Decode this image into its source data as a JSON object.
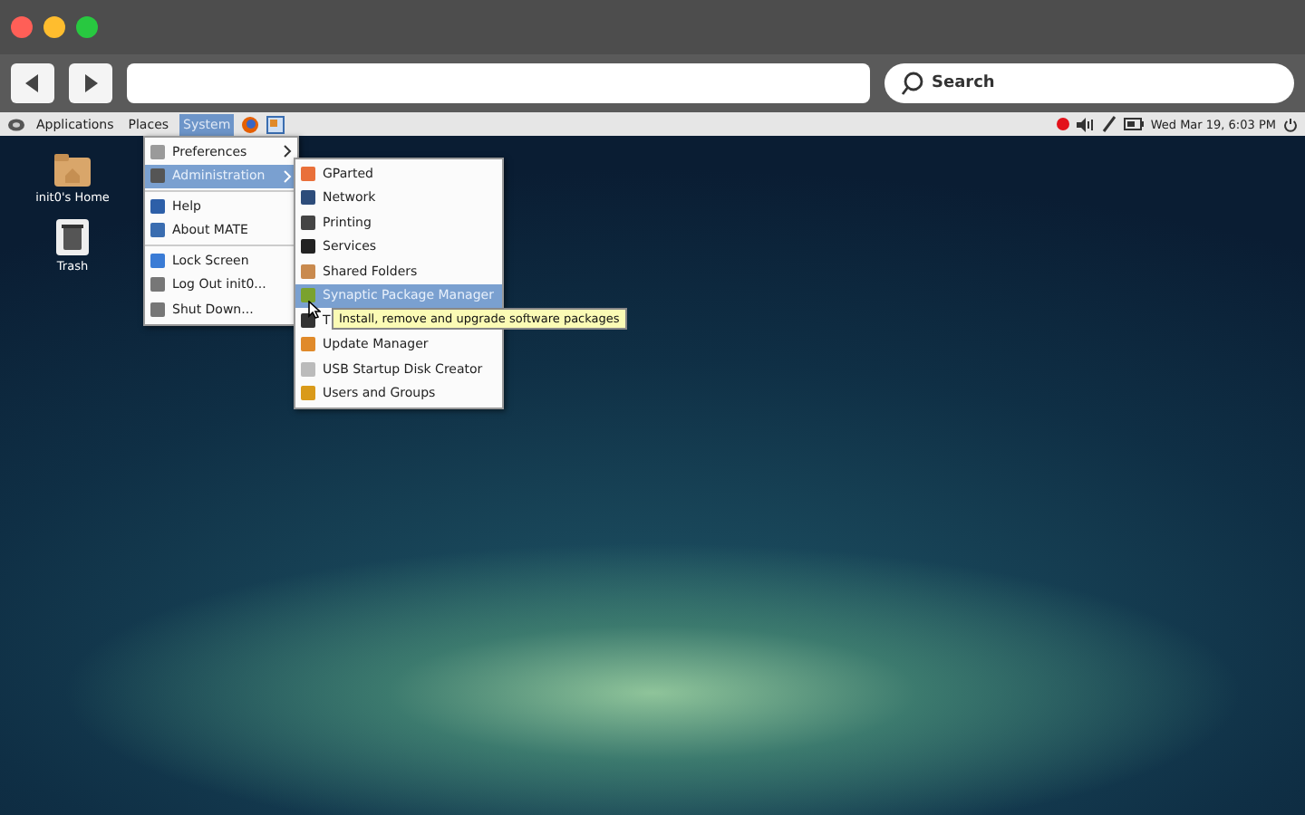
{
  "search": {
    "placeholder": "Search"
  },
  "panel": {
    "menus": [
      {
        "label": "Applications",
        "selected": false
      },
      {
        "label": "Places",
        "selected": false
      },
      {
        "label": "System",
        "selected": true
      }
    ],
    "clock": "Wed Mar 19,  6:03 PM"
  },
  "desktop_icons": [
    {
      "label": "init0's Home",
      "kind": "folder"
    },
    {
      "label": "Trash",
      "kind": "trash"
    }
  ],
  "system_menu": {
    "items": [
      {
        "kind": "submenu",
        "label": "Preferences",
        "selected": false
      },
      {
        "kind": "submenu",
        "label": "Administration",
        "selected": true
      },
      {
        "kind": "separator"
      },
      {
        "kind": "item",
        "label": "Help",
        "selected": false
      },
      {
        "kind": "item",
        "label": "About MATE",
        "selected": false
      },
      {
        "kind": "separator"
      },
      {
        "kind": "item",
        "label": "Lock Screen",
        "selected": false
      },
      {
        "kind": "item",
        "label": "Log Out init0...",
        "selected": false
      },
      {
        "kind": "item",
        "label": "Shut Down...",
        "selected": false
      }
    ]
  },
  "admin_menu": {
    "items": [
      {
        "label": "GParted",
        "selected": false
      },
      {
        "label": "Network",
        "selected": false
      },
      {
        "label": "Printing",
        "selected": false
      },
      {
        "label": "Services",
        "selected": false
      },
      {
        "label": "Shared Folders",
        "selected": false
      },
      {
        "label": "Synaptic Package Manager",
        "selected": true
      },
      {
        "label": "T",
        "selected": false
      },
      {
        "label": "Update Manager",
        "selected": false
      },
      {
        "label": "USB Startup Disk Creator",
        "selected": false
      },
      {
        "label": "Users and Groups",
        "selected": false
      }
    ]
  },
  "tooltip": {
    "text": "Install, remove and upgrade software packages"
  }
}
